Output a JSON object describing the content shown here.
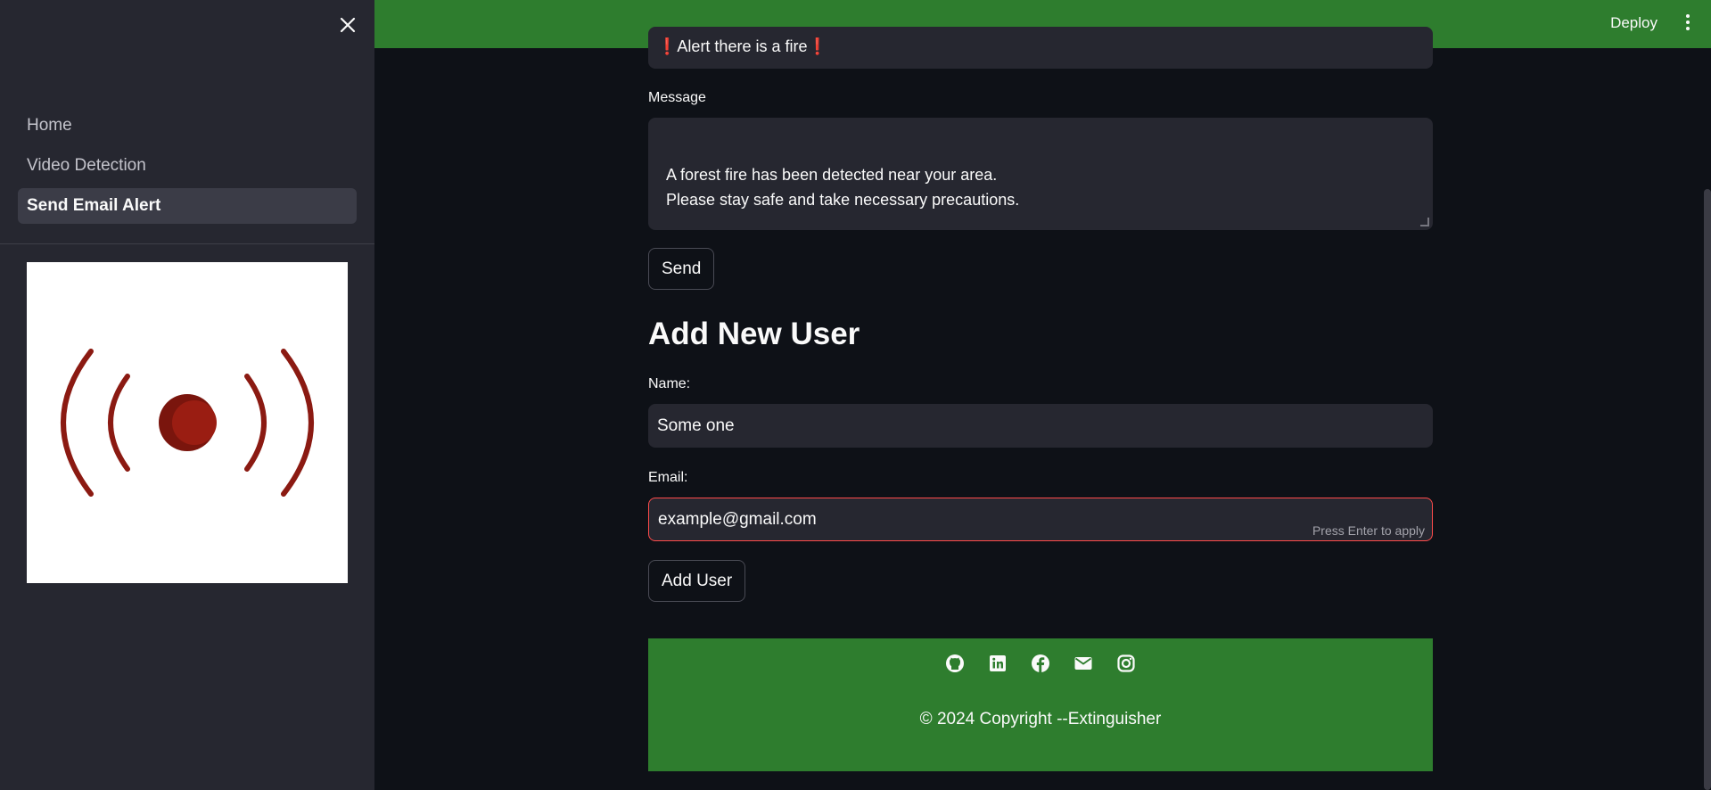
{
  "sidebar": {
    "close_icon": "close-icon",
    "items": [
      {
        "label": "Home",
        "active": false
      },
      {
        "label": "Video Detection",
        "active": false
      },
      {
        "label": "Send Email Alert",
        "active": true
      }
    ]
  },
  "header": {
    "deploy_label": "Deploy",
    "menu_icon": "kebab-menu-icon",
    "color": "#2e7d2e"
  },
  "email_form": {
    "subject_value": "Alert there is a fire",
    "message_label": "Message",
    "message_value": "A forest fire has been detected near your area.\nPlease stay safe and take necessary precautions.",
    "send_label": "Send"
  },
  "add_user": {
    "title": "Add New User",
    "name_label": "Name:",
    "name_value": "Some one",
    "email_label": "Email:",
    "email_value": "example@gmail.com",
    "email_hint": "Press Enter to apply",
    "button_label": "Add User"
  },
  "footer": {
    "icons": [
      "github-icon",
      "linkedin-icon",
      "facebook-icon",
      "email-icon",
      "instagram-icon"
    ],
    "copyright": "© 2024 Copyright --Extinguisher"
  },
  "colors": {
    "background": "#0e1117",
    "sidebar": "#262730",
    "accent_green": "#2e7d2e",
    "focus_red": "#ff4b4b",
    "alarm_red": "#8b1a12"
  }
}
